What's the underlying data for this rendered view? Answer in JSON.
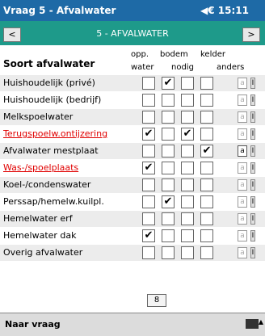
{
  "titlebar": {
    "title": "Vraag 5 - Afvalwater",
    "clock": "◀€ 15:11"
  },
  "nav": {
    "prev": "<",
    "next": ">",
    "title": "5 - AFVALWATER"
  },
  "table": {
    "header_label": "Soort afvalwater",
    "col_headers": [
      {
        "line1": "opp.",
        "line2": "water"
      },
      {
        "line1": "bodem",
        "line2": "nodig"
      },
      {
        "line1": "kelder",
        "line2": ""
      },
      {
        "line1": "",
        "line2": "anders"
      }
    ],
    "rows": [
      {
        "label": "Huishoudelijk (privé)",
        "red": false,
        "checks": [
          false,
          true,
          false,
          false
        ],
        "a": "a",
        "a_on": false,
        "i": "I"
      },
      {
        "label": "Huishoudelijk (bedrijf)",
        "red": false,
        "checks": [
          false,
          false,
          false,
          false
        ],
        "a": "a",
        "a_on": false,
        "i": "I"
      },
      {
        "label": "Melkspoelwater",
        "red": false,
        "checks": [
          false,
          false,
          false,
          false
        ],
        "a": "a",
        "a_on": false,
        "i": "I"
      },
      {
        "label": "Terugspoelw.ontijzering",
        "red": true,
        "checks": [
          true,
          false,
          true,
          false
        ],
        "a": "a",
        "a_on": false,
        "i": "I"
      },
      {
        "label": "Afvalwater mestplaat",
        "red": false,
        "checks": [
          false,
          false,
          false,
          true
        ],
        "a": "a",
        "a_on": true,
        "i": "I"
      },
      {
        "label": "Was-/spoelplaats",
        "red": true,
        "checks": [
          true,
          false,
          false,
          false
        ],
        "a": "a",
        "a_on": false,
        "i": "I"
      },
      {
        "label": "Koel-/condenswater",
        "red": false,
        "checks": [
          false,
          false,
          false,
          false
        ],
        "a": "a",
        "a_on": false,
        "i": "I"
      },
      {
        "label": "Perssap/hemelw.kuilpl.",
        "red": false,
        "checks": [
          false,
          true,
          false,
          false
        ],
        "a": "a",
        "a_on": false,
        "i": "I"
      },
      {
        "label": "Hemelwater erf",
        "red": false,
        "checks": [
          false,
          false,
          false,
          false
        ],
        "a": "a",
        "a_on": false,
        "i": "I"
      },
      {
        "label": "Hemelwater dak",
        "red": false,
        "checks": [
          true,
          false,
          false,
          false
        ],
        "a": "a",
        "a_on": false,
        "i": "I"
      },
      {
        "label": "Overig afvalwater",
        "red": false,
        "checks": [
          false,
          false,
          false,
          false
        ],
        "a": "a",
        "a_on": false,
        "i": "I"
      }
    ]
  },
  "page_number": "8",
  "bottom": {
    "label": "Naar vraag",
    "keyboard_icon": "keyboard-icon",
    "arrow": "▲"
  },
  "colors": {
    "titlebar": "#1e6aa6",
    "navbar": "#1e9a8a",
    "red_label": "#e00000"
  }
}
